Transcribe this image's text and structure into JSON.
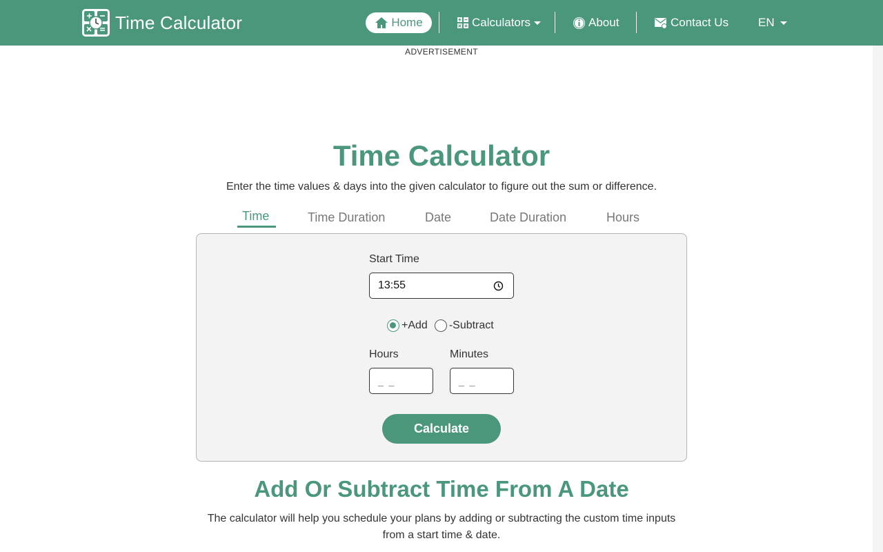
{
  "header": {
    "brand": "Time Calculator",
    "nav": {
      "home": "Home",
      "calculators": "Calculators",
      "about": "About",
      "contact": "Contact Us",
      "language": "EN"
    }
  },
  "ad_label": "ADVERTISEMENT",
  "main": {
    "title": "Time Calculator",
    "subtitle": "Enter the time values & days into the given calculator to figure out the sum or difference.",
    "tabs": [
      {
        "label": "Time",
        "active": true
      },
      {
        "label": "Time Duration",
        "active": false
      },
      {
        "label": "Date",
        "active": false
      },
      {
        "label": "Date Duration",
        "active": false
      },
      {
        "label": "Hours",
        "active": false
      }
    ]
  },
  "form": {
    "start_time_label": "Start Time",
    "start_time_value": "13:55",
    "radio_add": "+Add",
    "radio_subtract": "-Subtract",
    "selected_operation": "add",
    "hours_label": "Hours",
    "hours_placeholder": "_ _",
    "minutes_label": "Minutes",
    "minutes_placeholder": "_ _",
    "calculate": "Calculate"
  },
  "section": {
    "title": "Add Or Subtract Time From A Date",
    "text": "The calculator will help you schedule your plans by adding or subtracting the custom time inputs from a start time & date."
  },
  "colors": {
    "brand": "#4a977b",
    "card_bg": "#f3f3f3"
  }
}
